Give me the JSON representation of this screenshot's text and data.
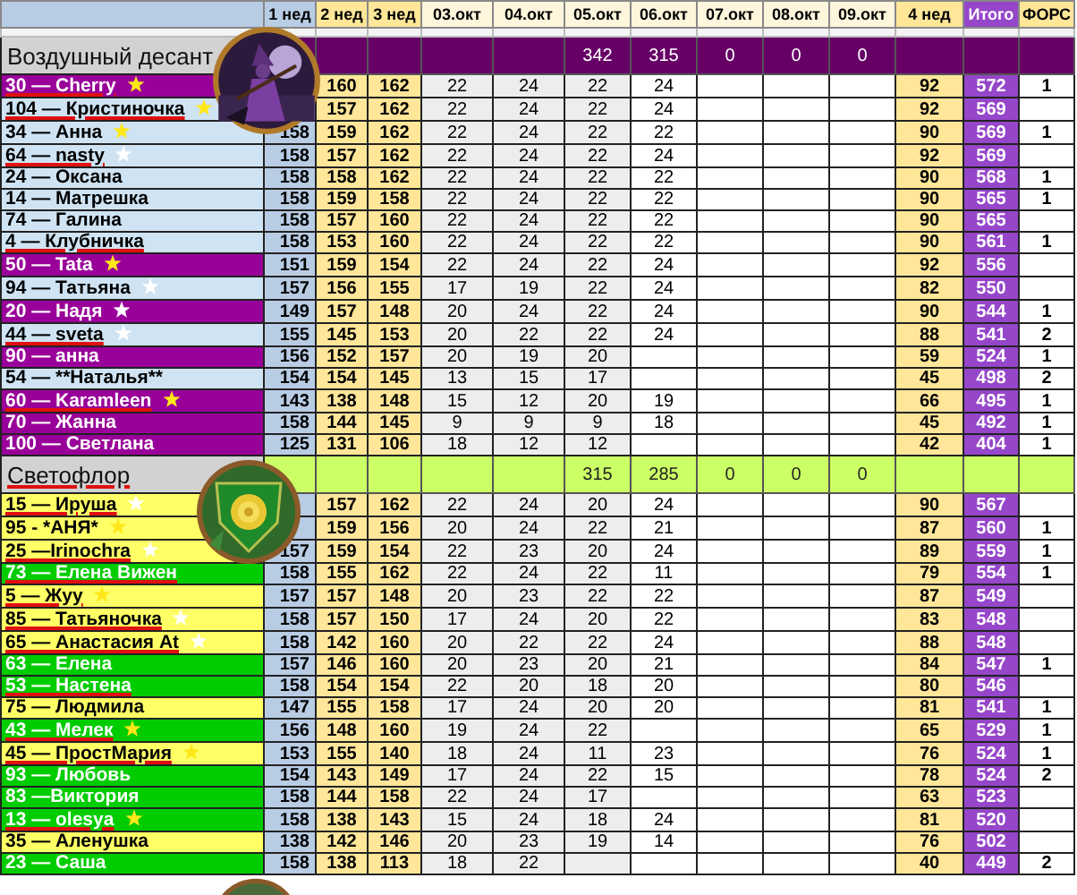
{
  "columns": [
    {
      "label": "1 нед"
    },
    {
      "label": "2 нед"
    },
    {
      "label": "3 нед"
    },
    {
      "label": "03.окт"
    },
    {
      "label": "04.окт"
    },
    {
      "label": "05.окт"
    },
    {
      "label": "06.окт"
    },
    {
      "label": "07.окт"
    },
    {
      "label": "08.окт"
    },
    {
      "label": "09.окт"
    },
    {
      "label": "4 нед"
    },
    {
      "label": "Итого"
    },
    {
      "label": "ФОРС"
    }
  ],
  "groups": [
    {
      "name": "Воздушный десант",
      "spell_error": false,
      "color": "#660066",
      "totals": {
        "oct_05": "342",
        "oct_06": "315",
        "oct_07": "0",
        "oct_08": "0",
        "oct_09": "0"
      },
      "rows": [
        {
          "name": "30 — Cherry",
          "color": "#990099",
          "star": {
            "color": "#ffe81a"
          },
          "spell_error": true,
          "week_2": "160",
          "week_3": "162",
          "oct_03": "22",
          "oct_04": "24",
          "oct_05": "22",
          "oct_06": "24",
          "week_4": "92",
          "total": "572",
          "fors": "1"
        },
        {
          "name": "104 — Кристиночка",
          "color": "#cfe3f3",
          "star": {
            "color": "#ffe81a"
          },
          "spell_error": true,
          "week_2": "157",
          "week_3": "162",
          "oct_03": "22",
          "oct_04": "24",
          "oct_05": "22",
          "oct_06": "24",
          "week_4": "92",
          "total": "569"
        },
        {
          "name": "34 — Анна",
          "color": "#cfe3f3",
          "star": {
            "color": "#ffe81a"
          },
          "spell_error": false,
          "week_1": "158",
          "week_2": "159",
          "week_3": "162",
          "oct_03": "22",
          "oct_04": "24",
          "oct_05": "22",
          "oct_06": "22",
          "week_4": "90",
          "total": "569",
          "fors": "1"
        },
        {
          "name": "64 — nasty",
          "color": "#cfe3f3",
          "star": {
            "color": "#ffffff"
          },
          "spell_error": true,
          "week_1": "158",
          "week_2": "157",
          "week_3": "162",
          "oct_03": "22",
          "oct_04": "24",
          "oct_05": "22",
          "oct_06": "24",
          "week_4": "92",
          "total": "569"
        },
        {
          "name": "24 — Оксана",
          "color": "#cfe3f3",
          "spell_error": false,
          "week_1": "158",
          "week_2": "158",
          "week_3": "162",
          "oct_03": "22",
          "oct_04": "24",
          "oct_05": "22",
          "oct_06": "22",
          "week_4": "90",
          "total": "568",
          "fors": "1"
        },
        {
          "name": "14 — Матрешка",
          "color": "#cfe3f3",
          "spell_error": false,
          "week_1": "158",
          "week_2": "159",
          "week_3": "158",
          "oct_03": "22",
          "oct_04": "24",
          "oct_05": "22",
          "oct_06": "22",
          "week_4": "90",
          "total": "565",
          "fors": "1"
        },
        {
          "name": "74 — Галина",
          "color": "#cfe3f3",
          "spell_error": false,
          "week_1": "158",
          "week_2": "157",
          "week_3": "160",
          "oct_03": "22",
          "oct_04": "24",
          "oct_05": "22",
          "oct_06": "22",
          "week_4": "90",
          "total": "565"
        },
        {
          "name": "4 — Клубничка",
          "color": "#cfe3f3",
          "spell_error": true,
          "week_1": "158",
          "week_2": "153",
          "week_3": "160",
          "oct_03": "22",
          "oct_04": "24",
          "oct_05": "22",
          "oct_06": "22",
          "week_4": "90",
          "total": "561",
          "fors": "1"
        },
        {
          "name": "50 — Tata",
          "color": "#990099",
          "star": {
            "color": "#ffe81a"
          },
          "spell_error": false,
          "week_1": "151",
          "week_2": "159",
          "week_3": "154",
          "oct_03": "22",
          "oct_04": "24",
          "oct_05": "22",
          "oct_06": "24",
          "week_4": "92",
          "total": "556"
        },
        {
          "name": "94 — Татьяна",
          "color": "#cfe3f3",
          "star": {
            "color": "#ffffff"
          },
          "spell_error": false,
          "week_1": "157",
          "week_2": "156",
          "week_3": "155",
          "oct_03": "17",
          "oct_04": "19",
          "oct_05": "22",
          "oct_06": "24",
          "week_4": "82",
          "total": "550"
        },
        {
          "name": "20 — Надя",
          "color": "#990099",
          "star": {
            "color": "#ffffff"
          },
          "spell_error": false,
          "week_1": "149",
          "week_2": "157",
          "week_3": "148",
          "oct_03": "20",
          "oct_04": "24",
          "oct_05": "22",
          "oct_06": "24",
          "week_4": "90",
          "total": "544",
          "fors": "1"
        },
        {
          "name": "44 — sveta",
          "color": "#cfe3f3",
          "star": {
            "color": "#ffffff"
          },
          "spell_error": true,
          "week_1": "155",
          "week_2": "145",
          "week_3": "153",
          "oct_03": "20",
          "oct_04": "22",
          "oct_05": "22",
          "oct_06": "24",
          "week_4": "88",
          "total": "541",
          "fors": "2"
        },
        {
          "name": "90 — анна",
          "color": "#990099",
          "spell_error": false,
          "week_1": "156",
          "week_2": "152",
          "week_3": "157",
          "oct_03": "20",
          "oct_04": "19",
          "oct_05": "20",
          "week_4": "59",
          "total": "524",
          "fors": "1"
        },
        {
          "name": "54 — **Наталья**",
          "color": "#cfe3f3",
          "spell_error": false,
          "week_1": "154",
          "week_2": "154",
          "week_3": "145",
          "oct_03": "13",
          "oct_04": "15",
          "oct_05": "17",
          "week_4": "45",
          "total": "498",
          "fors": "2"
        },
        {
          "name": "60 — Karamleen",
          "color": "#990099",
          "star": {
            "color": "#ffe81a"
          },
          "spell_error": true,
          "week_1": "143",
          "week_2": "138",
          "week_3": "148",
          "oct_03": "15",
          "oct_04": "12",
          "oct_05": "20",
          "oct_06": "19",
          "week_4": "66",
          "total": "495",
          "fors": "1"
        },
        {
          "name": "70 — Жанна",
          "color": "#990099",
          "spell_error": false,
          "week_1": "158",
          "week_2": "144",
          "week_3": "145",
          "oct_03": "9",
          "oct_04": "9",
          "oct_05": "9",
          "oct_06": "18",
          "week_4": "45",
          "total": "492",
          "fors": "1"
        },
        {
          "name": "100 — Светлана",
          "color": "#990099",
          "spell_error": false,
          "week_1": "125",
          "week_2": "131",
          "week_3": "106",
          "oct_03": "18",
          "oct_04": "12",
          "oct_05": "12",
          "week_4": "42",
          "total": "404",
          "fors": "1"
        }
      ]
    },
    {
      "name": "Светофлор",
      "spell_error": true,
      "color": "#ccff66",
      "totals": {
        "oct_05": "315",
        "oct_06": "285",
        "oct_07": "0",
        "oct_08": "0",
        "oct_09": "0"
      },
      "rows": [
        {
          "name": "15 — Ируша",
          "color": "#ffff66",
          "star": {
            "color": "#ffffff"
          },
          "spell_error": true,
          "week_2": "157",
          "week_3": "162",
          "oct_03": "22",
          "oct_04": "24",
          "oct_05": "20",
          "oct_06": "24",
          "week_4": "90",
          "total": "567"
        },
        {
          "name": "95 - *АНЯ*",
          "color": "#ffff66",
          "star": {
            "color": "#ffe81a"
          },
          "spell_error": false,
          "week_2": "159",
          "week_3": "156",
          "oct_03": "20",
          "oct_04": "24",
          "oct_05": "22",
          "oct_06": "21",
          "week_4": "87",
          "total": "560",
          "fors": "1"
        },
        {
          "name": "25 —Irinochra",
          "color": "#ffff66",
          "star": {
            "color": "#ffffff"
          },
          "spell_error": true,
          "week_1": "157",
          "week_2": "159",
          "week_3": "154",
          "oct_03": "22",
          "oct_04": "23",
          "oct_05": "20",
          "oct_06": "24",
          "week_4": "89",
          "total": "559",
          "fors": "1"
        },
        {
          "name": "73 — Елена Вижен",
          "color": "#00cc00",
          "spell_error": true,
          "week_1": "158",
          "week_2": "155",
          "week_3": "162",
          "oct_03": "22",
          "oct_04": "24",
          "oct_05": "22",
          "oct_06": "11",
          "week_4": "79",
          "total": "554",
          "fors": "1"
        },
        {
          "name": "5 — Жуу",
          "color": "#ffff66",
          "star": {
            "color": "#ffe81a"
          },
          "spell_error": true,
          "week_1": "157",
          "week_2": "157",
          "week_3": "148",
          "oct_03": "20",
          "oct_04": "23",
          "oct_05": "22",
          "oct_06": "22",
          "week_4": "87",
          "total": "549"
        },
        {
          "name": "85 — Татьяночка",
          "color": "#ffff66",
          "star": {
            "color": "#ffffff"
          },
          "spell_error": true,
          "week_1": "158",
          "week_2": "157",
          "week_3": "150",
          "oct_03": "17",
          "oct_04": "24",
          "oct_05": "20",
          "oct_06": "22",
          "week_4": "83",
          "total": "548"
        },
        {
          "name": "65 — Анастасия At",
          "color": "#ffff66",
          "star": {
            "color": "#ffffff"
          },
          "spell_error": true,
          "week_1": "158",
          "week_2": "142",
          "week_3": "160",
          "oct_03": "20",
          "oct_04": "22",
          "oct_05": "22",
          "oct_06": "24",
          "week_4": "88",
          "total": "548"
        },
        {
          "name": "63 — Елена",
          "color": "#00cc00",
          "spell_error": false,
          "week_1": "157",
          "week_2": "146",
          "week_3": "160",
          "oct_03": "20",
          "oct_04": "23",
          "oct_05": "20",
          "oct_06": "21",
          "week_4": "84",
          "total": "547",
          "fors": "1"
        },
        {
          "name": "53 — Настена",
          "color": "#00cc00",
          "spell_error": true,
          "week_1": "158",
          "week_2": "154",
          "week_3": "154",
          "oct_03": "22",
          "oct_04": "20",
          "oct_05": "18",
          "oct_06": "20",
          "week_4": "80",
          "total": "546"
        },
        {
          "name": "75 — Людмила",
          "color": "#ffff66",
          "spell_error": false,
          "week_1": "147",
          "week_2": "155",
          "week_3": "158",
          "oct_03": "17",
          "oct_04": "24",
          "oct_05": "20",
          "oct_06": "20",
          "week_4": "81",
          "total": "541",
          "fors": "1"
        },
        {
          "name": "43 — Мелек",
          "color": "#00cc00",
          "star": {
            "color": "#ffe81a"
          },
          "spell_error": true,
          "week_1": "156",
          "week_2": "148",
          "week_3": "160",
          "oct_03": "19",
          "oct_04": "24",
          "oct_05": "22",
          "week_4": "65",
          "total": "529",
          "fors": "1"
        },
        {
          "name": "45 — ПростМария",
          "color": "#ffff66",
          "star": {
            "color": "#ffe81a"
          },
          "spell_error": true,
          "week_1": "153",
          "week_2": "155",
          "week_3": "140",
          "oct_03": "18",
          "oct_04": "24",
          "oct_05": "11",
          "oct_06": "23",
          "week_4": "76",
          "total": "524",
          "fors": "1"
        },
        {
          "name": "93 — Любовь",
          "color": "#00cc00",
          "spell_error": false,
          "week_1": "154",
          "week_2": "143",
          "week_3": "149",
          "oct_03": "17",
          "oct_04": "24",
          "oct_05": "22",
          "oct_06": "15",
          "week_4": "78",
          "total": "524",
          "fors": "2"
        },
        {
          "name": "83 —Виктория",
          "color": "#00cc00",
          "spell_error": false,
          "week_1": "158",
          "week_2": "144",
          "week_3": "158",
          "oct_03": "22",
          "oct_04": "24",
          "oct_05": "17",
          "week_4": "63",
          "total": "523"
        },
        {
          "name": "13 — olesya",
          "color": "#00cc00",
          "star": {
            "color": "#ffe81a"
          },
          "spell_error": true,
          "week_1": "158",
          "week_2": "138",
          "week_3": "143",
          "oct_03": "15",
          "oct_04": "24",
          "oct_05": "18",
          "oct_06": "24",
          "week_4": "81",
          "total": "520"
        },
        {
          "name": "35 — Аленушка",
          "color": "#ffff66",
          "spell_error": false,
          "week_1": "138",
          "week_2": "142",
          "week_3": "146",
          "oct_03": "20",
          "oct_04": "23",
          "oct_05": "19",
          "oct_06": "14",
          "week_4": "76",
          "total": "502"
        },
        {
          "name": "23 — Саша",
          "color": "#00cc00",
          "spell_error": false,
          "week_1": "158",
          "week_2": "138",
          "week_3": "113",
          "oct_03": "18",
          "oct_04": "22",
          "week_4": "40",
          "total": "449",
          "fors": "2"
        }
      ]
    }
  ]
}
